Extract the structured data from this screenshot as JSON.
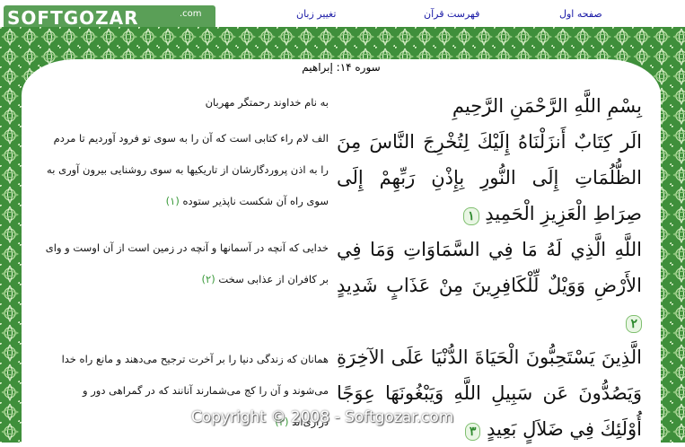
{
  "nav": {
    "home": "صفحه اول",
    "index": "فهرست قرآن",
    "language": "تغییر زبان"
  },
  "watermark": {
    "text": "SOFTGOZAR",
    "suffix": ".com"
  },
  "sura_title": "سوره ۱۴: إبراهیم",
  "verses": [
    {
      "arabic": "بِسْمِ اللَّهِ الرَّحْمَنِ الرَّحِيمِ",
      "persian": "به نام خداوند رحمتگر مهربان"
    },
    {
      "arabic": "الَر كِتَابٌ أَنزَلْنَاهُ إِلَيْكَ لِتُخْرِجَ النَّاسَ مِنَ الظُّلُمَاتِ إِلَى النُّورِ بِإِذْنِ رَبِّهِمْ إِلَى صِرَاطِ الْعَزِيزِ الْحَمِيدِ",
      "mark": "۱",
      "persian": "الف لام راء کتابى است که آن را به سوى تو فرود آورديم تا مردم را به اذن پروردگارشان از تاريکيها به سوى روشنايى بيرون آورى به سوى راه آن شکست ناپذير ستوده",
      "number": "(۱)"
    },
    {
      "arabic": "اللَّهِ الَّذِي لَهُ مَا فِي السَّمَاوَاتِ وَمَا فِي الأَرْضِ وَوَيْلٌ لِّلْكَافِرِينَ مِنْ عَذَابٍ شَدِيدٍ",
      "mark": "۲",
      "persian": "خدايى که آنچه در آسمانها و آنچه در زمين است از آن اوست و واى بر کافران از عذابى سخت",
      "number": "(۲)"
    },
    {
      "arabic": "الَّذِينَ يَسْتَحِبُّونَ الْحَيَاةَ الدُّنْيَا عَلَى الآخِرَةِ وَيَصُدُّونَ عَن سَبِيلِ اللَّهِ وَيَبْغُونَهَا عِوَجًا أُوْلَئِكَ فِي ضَلاَلٍ بَعِيدٍ",
      "mark": "۳",
      "persian": "همانان که زندگى دنيا را بر آخرت ترجيح مى‌دهند و مانع راه خدا مى‌شوند و آن را کج مى‌شمارند آنانند که در گمراهى دور و درازى‌اند",
      "number": "(۳)"
    }
  ],
  "copyright": "Copyright © 2008 - Softgozar.com",
  "colors": {
    "frame_green": "#3f8f3b",
    "link_blue": "#1a1aa6",
    "verse_number": "#3b9a3b"
  }
}
